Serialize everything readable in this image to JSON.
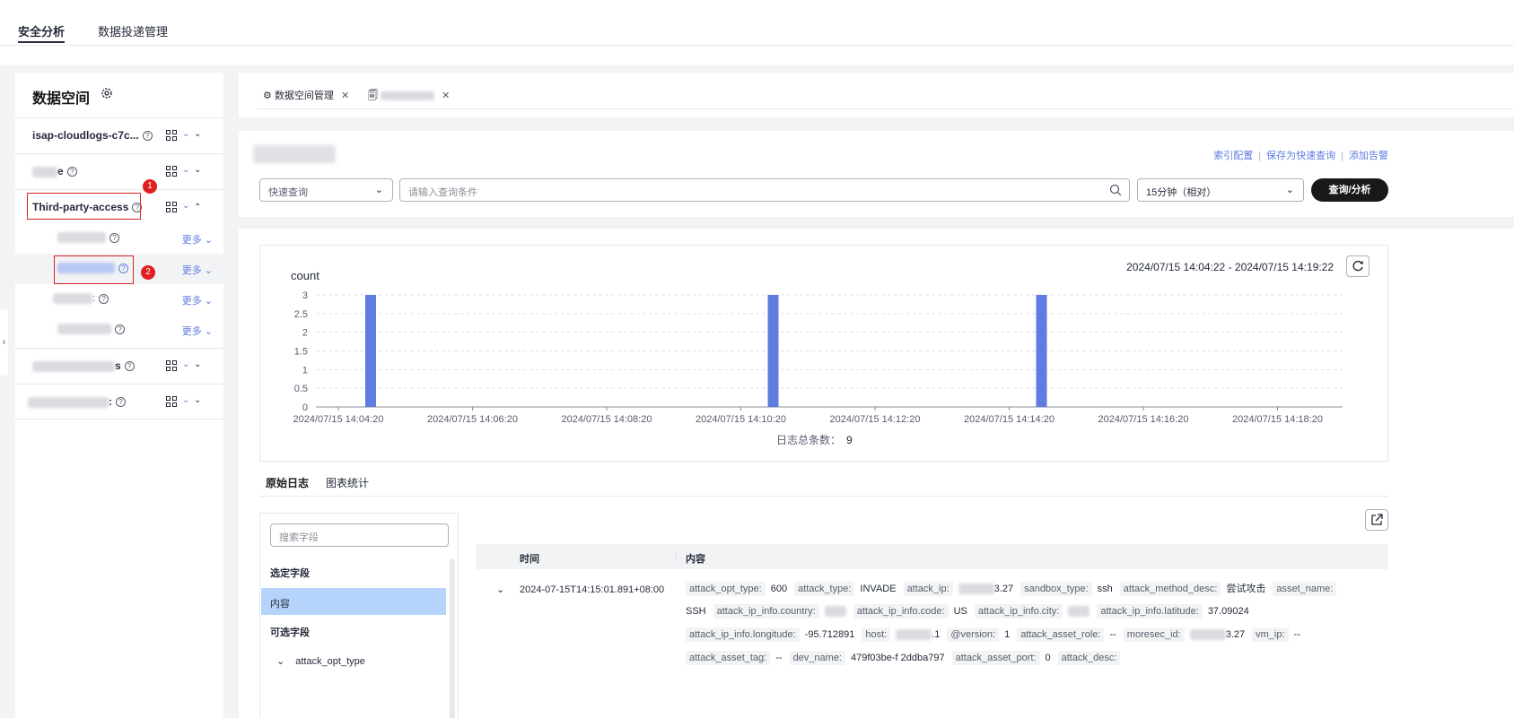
{
  "top_tabs": [
    "安全分析",
    "数据投递管理"
  ],
  "sidebar": {
    "title": "数据空间",
    "workspaces": [
      {
        "name": "isap-cloudlogs-c7c...",
        "expanded": false
      },
      {
        "name": "e",
        "expanded": false
      },
      {
        "name": "Third-party-access",
        "expanded": true
      },
      {
        "name": "s",
        "expanded": false
      },
      {
        "name": ":",
        "expanded": false
      }
    ],
    "pipes": [
      {
        "name": "",
        "more": "更多"
      },
      {
        "name": "",
        "more": "更多",
        "selected": true
      },
      {
        "name": ":",
        "more": "更多"
      },
      {
        "name": "",
        "more": "更多"
      }
    ],
    "annotations": [
      "1",
      "2"
    ]
  },
  "work_tabs": [
    {
      "label": "数据空间管理",
      "icon": "gear-icon"
    },
    {
      "label": "",
      "icon": "search-doc-icon"
    }
  ],
  "query": {
    "links": [
      "索引配置",
      "保存为快速查询",
      "添加告警"
    ],
    "quick_query_placeholder": "快速查询",
    "input_placeholder": "请输入查询条件",
    "time_select": "15分钟（相对）",
    "submit": "查询/分析"
  },
  "chart_data": {
    "type": "bar",
    "ylabel": "count",
    "yticks": [
      "3",
      "2.5",
      "2",
      "1.5",
      "1",
      "0.5",
      "0"
    ],
    "ylim": [
      0,
      3
    ],
    "xticks": [
      "2024/07/15 14:04:20",
      "2024/07/15 14:06:20",
      "2024/07/15 14:08:20",
      "2024/07/15 14:10:20",
      "2024/07/15 14:12:20",
      "2024/07/15 14:14:20",
      "2024/07/15 14:16:20",
      "2024/07/15 14:18:20"
    ],
    "bars": [
      {
        "x": "2024/07/15 14:04:20",
        "value": 3
      },
      {
        "x": "2024/07/15 14:10:20",
        "value": 3
      },
      {
        "x": "2024/07/15 14:14:20",
        "value": 3
      }
    ],
    "bar_color": "#5f7ce0",
    "grid": true,
    "time_range": "2024/07/15 14:04:22 - 2024/07/15 14:19:22"
  },
  "total_label": "日志总条数：",
  "total_count": "9",
  "log_tabs": [
    "原始日志",
    "图表统计"
  ],
  "fields": {
    "search_placeholder": "搜索字段",
    "selected_header": "选定字段",
    "selected_item": "内容",
    "optional_header": "可选字段",
    "optional_item": "attack_opt_type"
  },
  "table": {
    "col_time": "时间",
    "col_content": "内容",
    "row_time": "2024-07-15T14:15:01.891+08:00",
    "lines": [
      [
        [
          "attack_opt_type:",
          "600"
        ],
        [
          "attack_type:",
          "INVADE"
        ],
        [
          "attack_ip:",
          "3.27"
        ],
        [
          "sandbox_type:",
          "ssh"
        ],
        [
          "attack_method_desc:",
          "尝试攻击"
        ],
        [
          "asset_name:",
          ""
        ]
      ],
      [
        [
          "",
          "SSH"
        ],
        [
          "attack_ip_info.country:",
          ""
        ],
        [
          "attack_ip_info.code:",
          "US"
        ],
        [
          "attack_ip_info.city:",
          ""
        ],
        [
          "attack_ip_info.latitude:",
          "37.09024"
        ]
      ],
      [
        [
          "attack_ip_info.longitude:",
          "-95.712891"
        ],
        [
          "host:",
          ".1"
        ],
        [
          "@version:",
          "1"
        ],
        [
          "attack_asset_role:",
          "--"
        ],
        [
          "moresec_id:",
          "3.27"
        ],
        [
          "vm_ip:",
          "--"
        ]
      ],
      [
        [
          "attack_asset_tag:",
          "--"
        ],
        [
          "dev_name:",
          "479f03be-f 2ddba797"
        ],
        [
          "attack_asset_port:",
          "0"
        ],
        [
          "attack_desc:",
          ""
        ]
      ]
    ]
  }
}
